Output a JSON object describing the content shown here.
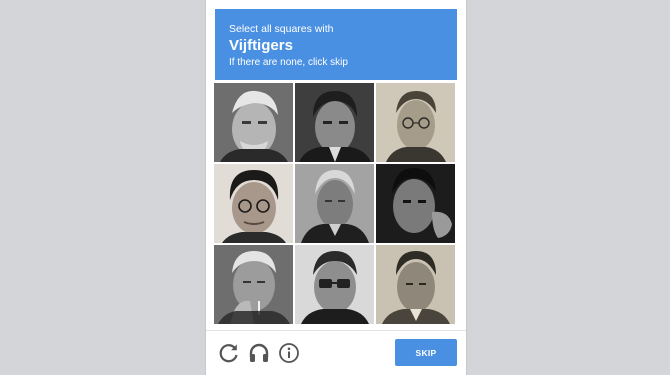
{
  "challenge": {
    "instruction": "Select all squares with",
    "keyword": "Vijftigers",
    "hint": "If there are none, click skip",
    "accent": "#4a90e2"
  },
  "tiles": [
    {
      "label": "portrait-1",
      "tone": "#9a9a9a"
    },
    {
      "label": "portrait-2",
      "tone": "#5e5e5e"
    },
    {
      "label": "portrait-3",
      "tone": "#b3aa96"
    },
    {
      "label": "portrait-4",
      "tone": "#a89a90"
    },
    {
      "label": "portrait-5",
      "tone": "#8f8f8f"
    },
    {
      "label": "portrait-6",
      "tone": "#6a6a6a"
    },
    {
      "label": "portrait-7",
      "tone": "#8c8c8c"
    },
    {
      "label": "portrait-8",
      "tone": "#9b9b9b"
    },
    {
      "label": "portrait-9",
      "tone": "#b6ad9c"
    }
  ],
  "footer": {
    "reload_icon": "reload-icon",
    "audio_icon": "headphones-icon",
    "info_icon": "info-icon",
    "skip_label": "SKIP"
  }
}
